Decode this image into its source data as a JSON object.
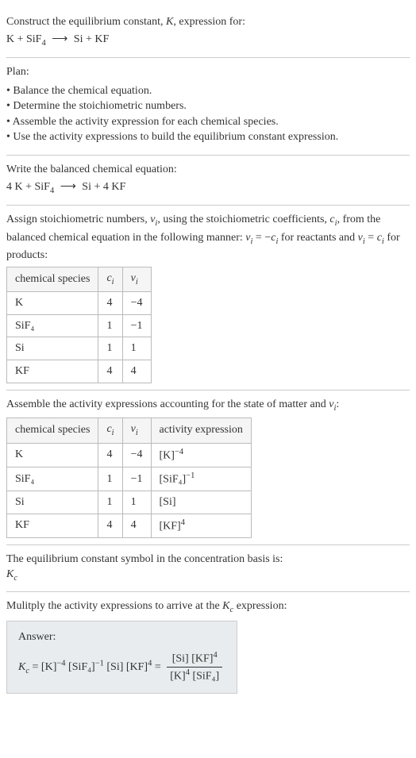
{
  "intro": {
    "line1": "Construct the equilibrium constant, ",
    "K": "K",
    "line1b": ", expression for:",
    "eq_left": "K + SiF",
    "eq_sub": "4",
    "eq_right": "Si + KF"
  },
  "plan": {
    "title": "Plan:",
    "items": [
      "Balance the chemical equation.",
      "Determine the stoichiometric numbers.",
      "Assemble the activity expression for each chemical species.",
      "Use the activity expressions to build the equilibrium constant expression."
    ]
  },
  "balanced": {
    "title": "Write the balanced chemical equation:",
    "left1": "4 K + SiF",
    "sub": "4",
    "right1": "Si + 4 KF"
  },
  "stoich": {
    "text_a": "Assign stoichiometric numbers, ",
    "nu": "ν",
    "sub_i": "i",
    "text_b": ", using the stoichiometric coefficients, ",
    "c": "c",
    "text_c": ", from the balanced chemical equation in the following manner: ",
    "rel1_pre": "ν",
    "rel1_mid": " = −",
    "rel1_post": " for reactants and ",
    "rel2_mid": " = ",
    "rel2_post": " for products:",
    "headers": [
      "chemical species",
      "cᵢ",
      "νᵢ"
    ],
    "rows": [
      {
        "sp": "K",
        "c": "4",
        "v": "−4"
      },
      {
        "sp": "SiF₄",
        "c": "1",
        "v": "−1"
      },
      {
        "sp": "Si",
        "c": "1",
        "v": "1"
      },
      {
        "sp": "KF",
        "c": "4",
        "v": "4"
      }
    ]
  },
  "activity": {
    "title_a": "Assemble the activity expressions accounting for the state of matter and ",
    "title_b": ":",
    "headers": [
      "chemical species",
      "cᵢ",
      "νᵢ",
      "activity expression"
    ],
    "rows": [
      {
        "sp": "K",
        "c": "4",
        "v": "−4",
        "expr_base": "[K]",
        "expr_exp": "−4"
      },
      {
        "sp": "SiF₄",
        "c": "1",
        "v": "−1",
        "expr_base": "[SiF₄]",
        "expr_exp": "−1"
      },
      {
        "sp": "Si",
        "c": "1",
        "v": "1",
        "expr_base": "[Si]",
        "expr_exp": ""
      },
      {
        "sp": "KF",
        "c": "4",
        "v": "4",
        "expr_base": "[KF]",
        "expr_exp": "4"
      }
    ]
  },
  "symbol": {
    "text": "The equilibrium constant symbol in the concentration basis is:",
    "kc": "K",
    "sub": "c"
  },
  "multiply": {
    "text_a": "Mulitply the activity expressions to arrive at the ",
    "text_b": " expression:"
  },
  "answer": {
    "label": "Answer:",
    "lhs": "K",
    "sub": "c",
    "t1": "[K]",
    "e1": "−4",
    "t2": "[SiF₄]",
    "e2": "−1",
    "t3": "[Si]",
    "t4": "[KF]",
    "e4": "4",
    "num_a": "[Si] [KF]",
    "num_exp": "4",
    "den_a": "[K]",
    "den_exp1": "4",
    "den_b": " [SiF₄]"
  }
}
